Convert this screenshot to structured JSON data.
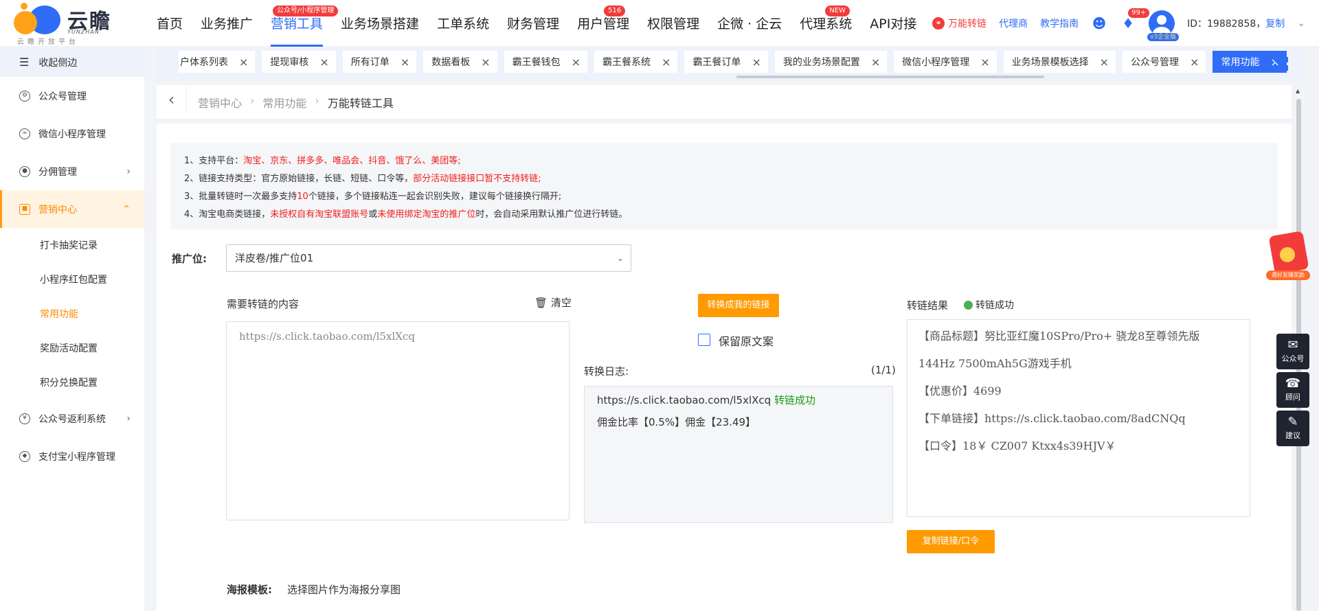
{
  "logo": {
    "name": "云瞻",
    "sub": "YUNZHAN",
    "slogan": "云瞻开放平台"
  },
  "nav": {
    "items": [
      {
        "label": "首页"
      },
      {
        "label": "业务推广"
      },
      {
        "label": "营销工具",
        "badge": "公众号/小程序管理"
      },
      {
        "label": "业务场景搭建"
      },
      {
        "label": "工单系统"
      },
      {
        "label": "财务管理"
      },
      {
        "label": "用户管理",
        "badge": "516"
      },
      {
        "label": "权限管理"
      },
      {
        "label": "企微 · 企云"
      },
      {
        "label": "代理系统",
        "badge": "NEW"
      },
      {
        "label": "API对接"
      }
    ]
  },
  "header": {
    "convert": "万能转链",
    "agent": "代理商",
    "guide": "教学指南",
    "notify_badge": "99+",
    "vip": "v3企业版",
    "user_id": "ID：19882858，",
    "copy": "复制"
  },
  "sidebar": {
    "collapse": "收起侧边",
    "items": [
      {
        "label": "公众号管理"
      },
      {
        "label": "微信小程序管理"
      },
      {
        "label": "分佣管理"
      },
      {
        "label": "营销中心"
      },
      {
        "label": "公众号返利系统"
      },
      {
        "label": "支付宝小程序管理"
      }
    ],
    "sub_items": [
      "打卡抽奖记录",
      "小程序红包配置",
      "常用功能",
      "奖励活动配置",
      "积分兑换配置"
    ]
  },
  "tabs": [
    "户体系列表",
    "提现审核",
    "所有订单",
    "数据看板",
    "霸王餐钱包",
    "霸王餐系统",
    "霸王餐订单",
    "我的业务场景配置",
    "微信小程序管理",
    "业务场景模板选择",
    "公众号管理",
    "常用功能"
  ],
  "breadcrumb": {
    "a": "营销中心",
    "b": "常用功能",
    "c": "万能转链工具",
    "sep": "›"
  },
  "notes": {
    "l1_pre": "1、支持平台：",
    "l1_red": "淘宝、京东、拼多多、唯品会、抖音、饿了么、美团等;",
    "l2_pre": "2、链接支持类型：官方原始链接，长链、短链、口令等，",
    "l2_red": "部分活动链接接口暂不支持转链;",
    "l3_pre": "3、批量转链时一次最多支持",
    "l3_red": "10",
    "l3_post": "个链接，多个链接粘连一起会识别失败，建议每个链接换行隔开;",
    "l4_pre": "4、淘宝电商类链接，",
    "l4_red1": "未授权自有淘宝联盟账号",
    "l4_mid": "或",
    "l4_red2": "未使用绑定淘宝的推广位",
    "l4_post": "时，会自动采用默认推广位进行转链。"
  },
  "form": {
    "promo_label": "推广位:",
    "promo_value": "洋皮卷/推广位01",
    "content_label": "需要转链的内容",
    "clear": "清空",
    "input_placeholder": "https://s.click.taobao.com/l5xlXcq",
    "convert_btn": "转换成我的链接",
    "keep_text": "保留原文案",
    "log_label": "转换日志:",
    "log_count": "(1/1)",
    "log_url": "https://s.click.taobao.com/l5xlXcq",
    "log_status": "转链成功",
    "log_commission": "佣金比率【0.5%】佣金【23.49】",
    "result_label": "转链结果",
    "result_status": "转链成功",
    "result_lines": [
      "【商品标题】努比亚红魔10SPro/Pro+ 骁龙8至尊领先版 144Hz 7500mAh5G游戏手机",
      "【优惠价】4699",
      "【下单链接】https://s.click.taobao.com/8adCNQq",
      "【口令】18￥ CZ007 Ktxx4s39HJV￥"
    ],
    "copy_btn": "复制链接/口令",
    "poster_label": "海报模板:",
    "poster_hint": "选择图片作为海报分享图"
  },
  "float": {
    "redpack": "邀好友赚奖励",
    "btn1": "公众号",
    "btn2": "顾问",
    "btn3": "建议"
  }
}
